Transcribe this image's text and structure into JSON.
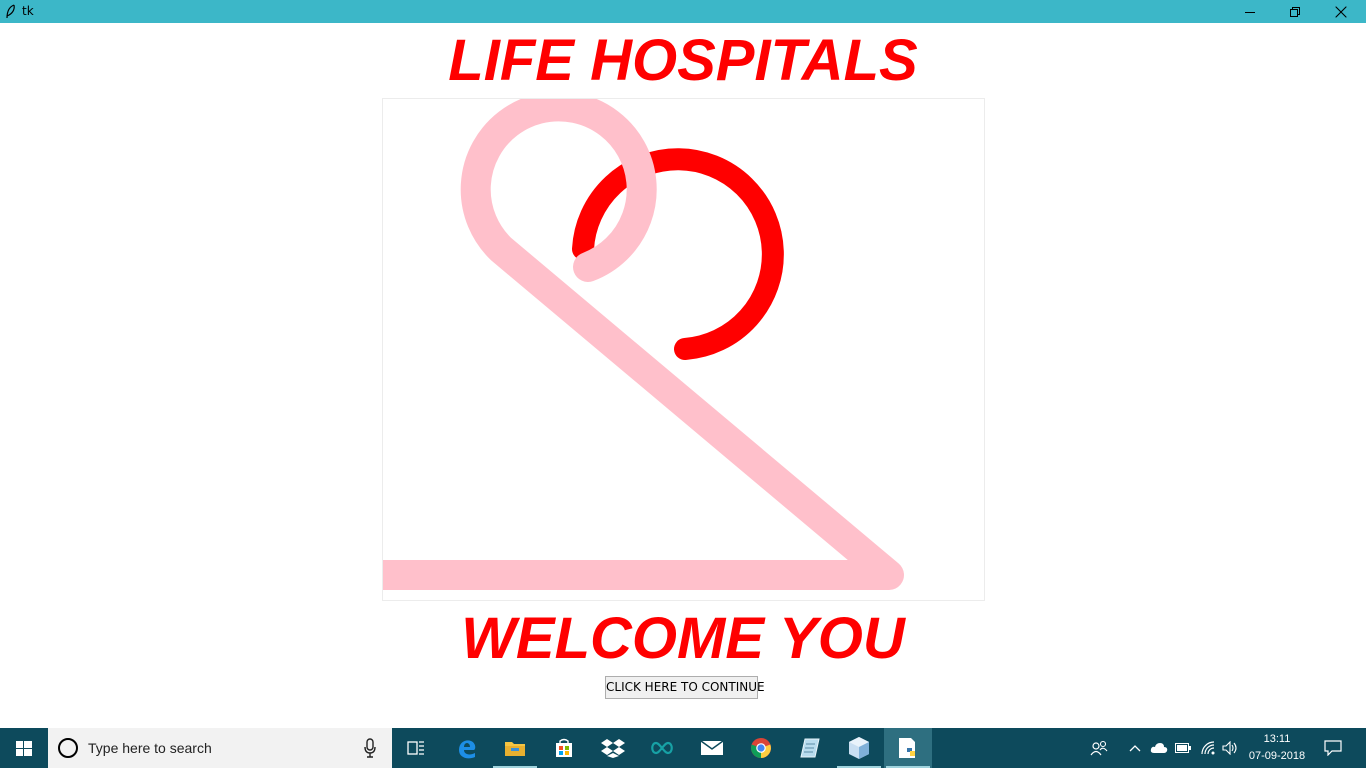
{
  "window": {
    "title": "tk"
  },
  "content": {
    "heading": "LIFE HOSPITALS",
    "welcome": "WELCOME YOU",
    "continue_button": "CLICK HERE TO CONTINUE"
  },
  "colors": {
    "heading": "#ff0000",
    "red_stroke": "#ff0000",
    "pink_stroke": "#ffc0cb",
    "titlebar": "#3cb7c8",
    "taskbar": "#0d4a5c"
  },
  "taskbar": {
    "search_placeholder": "Type here to search",
    "apps": [
      "task-view-icon",
      "edge-icon",
      "file-explorer-icon",
      "store-icon",
      "dropbox-icon",
      "arduino-icon",
      "mail-icon",
      "chrome-icon",
      "notepad-icon",
      "virtualbox-icon",
      "python-idle-icon"
    ],
    "time": "13:11",
    "date": "07-09-2018"
  }
}
